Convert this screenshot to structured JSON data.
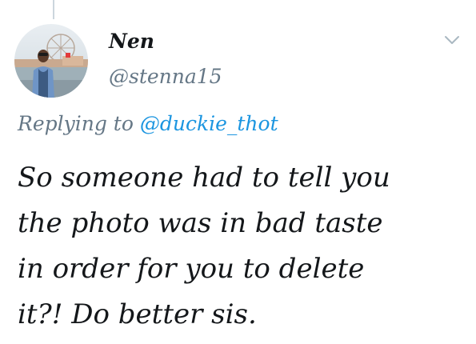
{
  "tweet": {
    "author": {
      "display_name": "Nen",
      "handle": "@stenna15",
      "avatar_icon": "profile-photo"
    },
    "menu_icon": "chevron-down-icon",
    "reply": {
      "label": "Replying to",
      "mention": "@duckie_thot"
    },
    "text_lines": [
      "So someone had to tell you",
      "the photo was in bad taste",
      "in order for you to delete",
      "it?! Do better sis."
    ]
  },
  "colors": {
    "text_primary": "#14171a",
    "text_secondary": "#657786",
    "link": "#1b95e0",
    "thread_line": "#ccd6dd",
    "chevron": "#aab8c2"
  }
}
